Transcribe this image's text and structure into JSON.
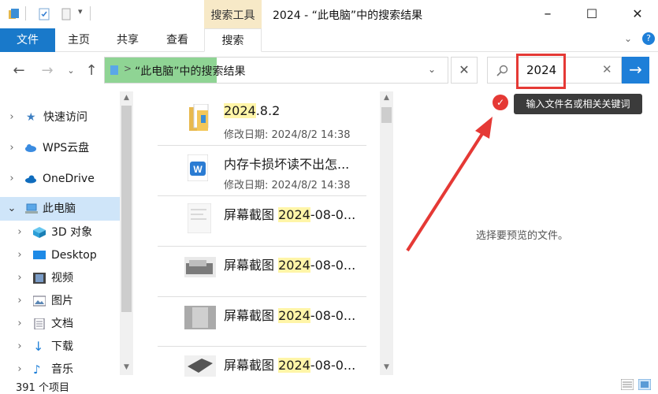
{
  "window": {
    "context_tab": "搜索工具",
    "title": "2024 - “此电脑”中的搜索结果",
    "minimize": "–",
    "maximize": "☐",
    "close": "✕"
  },
  "ribbon": {
    "tabs": [
      "文件",
      "主页",
      "共享",
      "查看",
      "搜索"
    ]
  },
  "address": {
    "path_separator": ">",
    "path": "“此电脑”中的搜索结果",
    "search_value": "2024"
  },
  "tooltip": "输入文件名或相关关键词",
  "nav": {
    "items": [
      {
        "label": "快速访问",
        "icon": "star-icon"
      },
      {
        "label": "WPS云盘",
        "icon": "cloud-icon"
      },
      {
        "label": "OneDrive",
        "icon": "onedrive-icon"
      },
      {
        "label": "此电脑",
        "icon": "computer-icon"
      },
      {
        "label": "3D 对象",
        "icon": "cube-icon"
      },
      {
        "label": "Desktop",
        "icon": "desktop-icon"
      },
      {
        "label": "视频",
        "icon": "video-icon"
      },
      {
        "label": "图片",
        "icon": "picture-icon"
      },
      {
        "label": "文档",
        "icon": "document-icon"
      },
      {
        "label": "下载",
        "icon": "download-icon"
      },
      {
        "label": "音乐",
        "icon": "music-icon"
      }
    ]
  },
  "results": [
    {
      "hl": "2024",
      "rest": ".8.2",
      "meta": "修改日期: 2024/8/2 14:38",
      "icon": "folder-icon"
    },
    {
      "pre": "内存卡损坏读不出怎...",
      "meta": "修改日期: 2024/8/2 14:38",
      "icon": "word-doc-icon"
    },
    {
      "pre": "屏幕截图 ",
      "hl": "2024",
      "rest": "-08-0...",
      "icon": "image-thumb"
    },
    {
      "pre": "屏幕截图 ",
      "hl": "2024",
      "rest": "-08-0...",
      "icon": "image-thumb"
    },
    {
      "pre": "屏幕截图 ",
      "hl": "2024",
      "rest": "-08-0...",
      "icon": "image-thumb"
    },
    {
      "pre": "屏幕截图 ",
      "hl": "2024",
      "rest": "-08-0...",
      "icon": "image-thumb"
    }
  ],
  "preview": "选择要预览的文件。",
  "status": {
    "count": "391 个项目"
  },
  "colors": {
    "accent": "#1979ca",
    "search_go": "#1e7fd8",
    "highlight": "#fff5a8",
    "annotation_red": "#e53935",
    "address_fill": "#8fd494",
    "context_tab": "#f7e9c7"
  }
}
